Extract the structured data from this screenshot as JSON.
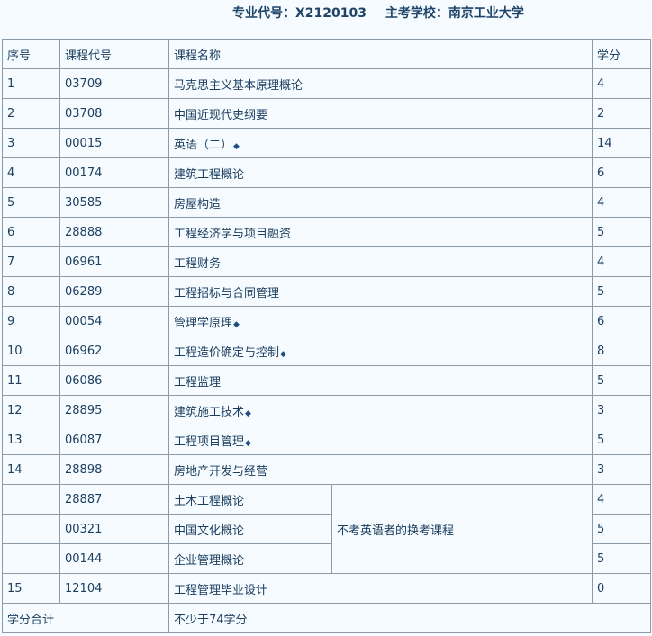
{
  "header": {
    "major_code": "专业代号：X2120103",
    "school": "主考学校：南京工业大学"
  },
  "table": {
    "columns": [
      "序号",
      "课程代号",
      "课程名称",
      "学分"
    ],
    "rows": [
      {
        "no": "1",
        "code": "03709",
        "name": "马克思主义基本原理概论",
        "credit": "4",
        "mark": ""
      },
      {
        "no": "2",
        "code": "03708",
        "name": "中国近现代史纲要",
        "credit": "2",
        "mark": ""
      },
      {
        "no": "3",
        "code": "00015",
        "name": "英语（二）",
        "credit": "14",
        "mark": "◆"
      },
      {
        "no": "4",
        "code": "00174",
        "name": "建筑工程概论",
        "credit": "6",
        "mark": ""
      },
      {
        "no": "5",
        "code": "30585",
        "name": "房屋构造",
        "credit": "4",
        "mark": ""
      },
      {
        "no": "6",
        "code": "28888",
        "name": "工程经济学与项目融资",
        "credit": "5",
        "mark": ""
      },
      {
        "no": "7",
        "code": "06961",
        "name": "工程财务",
        "credit": "4",
        "mark": ""
      },
      {
        "no": "8",
        "code": "06289",
        "name": "工程招标与合同管理",
        "credit": "5",
        "mark": ""
      },
      {
        "no": "9",
        "code": "00054",
        "name": "管理学原理",
        "credit": "6",
        "mark": "◆"
      },
      {
        "no": "10",
        "code": "06962",
        "name": "工程造价确定与控制",
        "credit": "8",
        "mark": "◆"
      },
      {
        "no": "11",
        "code": "06086",
        "name": "工程监理",
        "credit": "5",
        "mark": ""
      },
      {
        "no": "12",
        "code": "28895",
        "name": "建筑施工技术",
        "credit": "3",
        "mark": "◆"
      },
      {
        "no": "13",
        "code": "06087",
        "name": "工程项目管理",
        "credit": "5",
        "mark": "◆"
      },
      {
        "no": "14",
        "code": "28898",
        "name": "房地产开发与经营",
        "credit": "3",
        "mark": ""
      }
    ],
    "substitutes": {
      "note": "不考英语者的换考课程",
      "rows": [
        {
          "code": "28887",
          "name": "土木工程概论",
          "credit": "4"
        },
        {
          "code": "00321",
          "name": "中国文化概论",
          "credit": "5"
        },
        {
          "code": "00144",
          "name": "企业管理概论",
          "credit": "5"
        }
      ]
    },
    "final_row": {
      "no": "15",
      "code": "12104",
      "name": "工程管理毕业设计",
      "credit": "0"
    },
    "total": {
      "label": "学分合计",
      "value": "不少于74学分"
    }
  }
}
